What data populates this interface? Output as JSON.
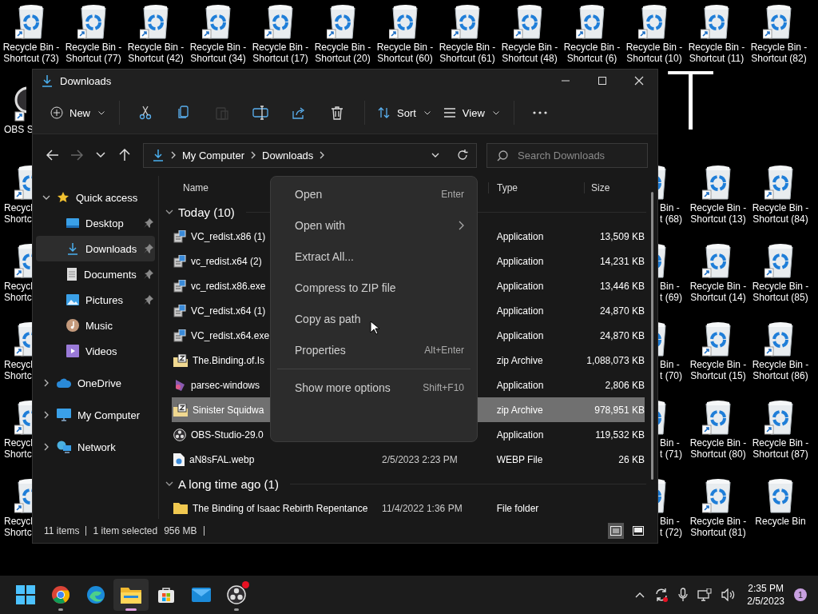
{
  "desktop": {
    "letter": "T",
    "top_row": [
      {
        "kind": "bin",
        "shortcut": true,
        "lines": [
          "Recycle Bin -",
          "Shortcut (73)"
        ]
      },
      {
        "kind": "bin",
        "shortcut": true,
        "lines": [
          "Recycle Bin -",
          "Shortcut (77)"
        ]
      },
      {
        "kind": "bin",
        "shortcut": true,
        "lines": [
          "Recycle Bin -",
          "Shortcut (42)"
        ]
      },
      {
        "kind": "bin",
        "shortcut": true,
        "lines": [
          "Recycle Bin -",
          "Shortcut (34)"
        ]
      },
      {
        "kind": "bin",
        "shortcut": true,
        "lines": [
          "Recycle Bin -",
          "Shortcut (17)"
        ]
      },
      {
        "kind": "bin",
        "shortcut": true,
        "lines": [
          "Recycle Bin -",
          "Shortcut (20)"
        ]
      },
      {
        "kind": "bin",
        "shortcut": true,
        "lines": [
          "Recycle Bin -",
          "Shortcut (60)"
        ]
      },
      {
        "kind": "bin",
        "shortcut": true,
        "lines": [
          "Recycle Bin -",
          "Shortcut (61)"
        ]
      },
      {
        "kind": "bin",
        "shortcut": true,
        "lines": [
          "Recycle Bin -",
          "Shortcut (48)"
        ]
      },
      {
        "kind": "bin",
        "shortcut": true,
        "lines": [
          "Recycle Bin -",
          "Shortcut (6)"
        ]
      },
      {
        "kind": "bin",
        "shortcut": true,
        "lines": [
          "Recycle Bin -",
          "Shortcut (10)"
        ]
      },
      {
        "kind": "bin",
        "shortcut": true,
        "lines": [
          "Recycle Bin -",
          "Shortcut (11)"
        ]
      },
      {
        "kind": "bin",
        "shortcut": true,
        "lines": [
          "Recycle Bin -",
          "Shortcut (82)"
        ]
      }
    ],
    "left_column": [
      {
        "kind": "obs",
        "shortcut": true,
        "lines": [
          "OBS S"
        ]
      },
      {
        "kind": "bin",
        "shortcut": true,
        "lines": [
          "Recycl",
          "Shortc"
        ]
      },
      {
        "kind": "bin",
        "shortcut": true,
        "lines": [
          "Recycl",
          "Shortc"
        ]
      },
      {
        "kind": "bin",
        "shortcut": true,
        "lines": [
          "Recycl",
          "Shortc"
        ]
      },
      {
        "kind": "bin",
        "shortcut": true,
        "lines": [
          "Recycl",
          "Shortc"
        ]
      },
      {
        "kind": "bin",
        "shortcut": true,
        "lines": [
          "Recycl",
          "Shortc"
        ]
      }
    ],
    "right_columns": [
      [
        {
          "kind": "bin",
          "lines": [
            "Bin -",
            "t (68)"
          ]
        },
        {
          "kind": "bin",
          "lines": [
            "Bin -",
            "t (69)"
          ]
        },
        {
          "kind": "bin",
          "lines": [
            "Bin -",
            "t (70)"
          ]
        },
        {
          "kind": "bin",
          "lines": [
            "Bin -",
            "t (71)"
          ]
        },
        {
          "kind": "bin",
          "lines": [
            "Bin -",
            "t (72)"
          ]
        }
      ],
      [
        {
          "kind": "bin",
          "shortcut": true,
          "lines": [
            "Recycle Bin -",
            "Shortcut (13)"
          ]
        },
        {
          "kind": "bin",
          "shortcut": true,
          "lines": [
            "Recycle Bin -",
            "Shortcut (14)"
          ]
        },
        {
          "kind": "bin",
          "shortcut": true,
          "lines": [
            "Recycle Bin -",
            "Shortcut (15)"
          ]
        },
        {
          "kind": "bin",
          "shortcut": true,
          "lines": [
            "Recycle Bin -",
            "Shortcut (80)"
          ]
        },
        {
          "kind": "bin",
          "shortcut": true,
          "lines": [
            "Recycle Bin -",
            "Shortcut (81)"
          ]
        }
      ],
      [
        {
          "kind": "bin",
          "shortcut": true,
          "lines": [
            "Recycle Bin -",
            "Shortcut (84)"
          ]
        },
        {
          "kind": "bin",
          "shortcut": true,
          "lines": [
            "Recycle Bin -",
            "Shortcut (85)"
          ]
        },
        {
          "kind": "bin",
          "shortcut": true,
          "lines": [
            "Recycle Bin -",
            "Shortcut (86)"
          ]
        },
        {
          "kind": "bin",
          "shortcut": true,
          "lines": [
            "Recycle Bin -",
            "Shortcut (87)"
          ]
        },
        {
          "kind": "bin",
          "shortcut": false,
          "lines": [
            "Recycle Bin"
          ]
        }
      ]
    ]
  },
  "window": {
    "title": "Downloads",
    "toolbar": [
      {
        "kind": "new",
        "label": "New",
        "disabled": false
      },
      {
        "kind": "cut",
        "disabled": false
      },
      {
        "kind": "copy",
        "disabled": false
      },
      {
        "kind": "paste",
        "disabled": true
      },
      {
        "kind": "rename",
        "disabled": false
      },
      {
        "kind": "share",
        "disabled": false
      },
      {
        "kind": "delete",
        "disabled": false
      },
      {
        "kind": "sort",
        "label": "Sort",
        "disabled": false
      },
      {
        "kind": "view",
        "label": "View",
        "disabled": false
      },
      {
        "kind": "more",
        "disabled": false
      }
    ],
    "nav": [
      {
        "kind": "back",
        "disabled": false
      },
      {
        "kind": "forward",
        "disabled": true
      },
      {
        "kind": "recent",
        "disabled": false
      },
      {
        "kind": "up",
        "disabled": false
      }
    ],
    "address": [
      "My Computer",
      "Downloads"
    ],
    "search": {
      "placeholder": "Search Downloads"
    },
    "sidebar": {
      "items": [
        {
          "label": "Quick access",
          "kind": "star",
          "expanded": true,
          "selected": false,
          "children": [
            {
              "label": "Desktop",
              "kind": "desktop",
              "pinned": true,
              "selected": false
            },
            {
              "label": "Downloads",
              "kind": "download",
              "pinned": true,
              "selected": true
            },
            {
              "label": "Documents",
              "kind": "documents",
              "pinned": true,
              "selected": false
            },
            {
              "label": "Pictures",
              "kind": "pictures",
              "pinned": true,
              "selected": false
            },
            {
              "label": "Music",
              "kind": "music",
              "pinned": false,
              "selected": false
            },
            {
              "label": "Videos",
              "kind": "videos",
              "pinned": false,
              "selected": false
            }
          ]
        },
        {
          "label": "OneDrive",
          "kind": "cloud",
          "expanded": false,
          "selected": false
        },
        {
          "label": "My Computer",
          "kind": "computer",
          "expanded": false,
          "selected": false
        },
        {
          "label": "Network",
          "kind": "network",
          "expanded": false,
          "selected": false
        }
      ]
    },
    "columns": {
      "name": "Name",
      "type": "Type",
      "size": "Size"
    },
    "groups": [
      {
        "label": "Today (10)",
        "expanded": true,
        "files": [
          {
            "kind": "installer",
            "name": "VC_redist.x86 (1)",
            "type": "Application",
            "size": "13,509 KB",
            "selected": false
          },
          {
            "kind": "installer",
            "name": "vc_redist.x64 (2)",
            "type": "Application",
            "size": "14,231 KB",
            "selected": false
          },
          {
            "kind": "installer",
            "name": "vc_redist.x86.exe",
            "type": "Application",
            "size": "13,446 KB",
            "selected": false
          },
          {
            "kind": "installer",
            "name": "VC_redist.x64 (1)",
            "type": "Application",
            "size": "24,870 KB",
            "selected": false
          },
          {
            "kind": "installer",
            "name": "VC_redist.x64.exe",
            "type": "Application",
            "size": "24,870 KB",
            "selected": false
          },
          {
            "kind": "zip",
            "name": "The.Binding.of.Is",
            "type": "zip Archive",
            "size": "1,088,073 KB",
            "selected": false
          },
          {
            "kind": "parsec",
            "name": "parsec-windows",
            "type": "Application",
            "size": "2,806 KB",
            "selected": false
          },
          {
            "kind": "zip",
            "name": "Sinister Squidwa",
            "type": "zip Archive",
            "size": "978,951 KB",
            "selected": true
          },
          {
            "kind": "obs",
            "name": "OBS-Studio-29.0",
            "type": "Application",
            "size": "119,532 KB",
            "selected": false
          },
          {
            "kind": "webp",
            "name": "aN8sFAL.webp",
            "date": "2/5/2023 2:23 PM",
            "type": "WEBP File",
            "size": "26 KB",
            "selected": false
          }
        ]
      },
      {
        "label": "A long time ago (1)",
        "expanded": true,
        "files": [
          {
            "kind": "folder",
            "name": "The Binding of Isaac Rebirth Repentance",
            "date": "11/4/2022 1:36 PM",
            "type": "File folder",
            "selected": false
          }
        ]
      }
    ],
    "context_menu": [
      {
        "kind": "item",
        "label": "Open",
        "shortcut": "Enter",
        "submenu": false
      },
      {
        "kind": "item",
        "label": "Open with",
        "submenu": true
      },
      {
        "kind": "item",
        "label": "Extract All...",
        "submenu": false
      },
      {
        "kind": "item",
        "label": "Compress to ZIP file",
        "submenu": false
      },
      {
        "kind": "item",
        "label": "Copy as path",
        "submenu": false
      },
      {
        "kind": "item",
        "label": "Properties",
        "shortcut": "Alt+Enter",
        "submenu": false
      },
      {
        "kind": "separator"
      },
      {
        "kind": "item",
        "label": "Show more options",
        "shortcut": "Shift+F10",
        "submenu": false
      }
    ],
    "status_bar": {
      "count": "11 items",
      "selection": "1 item selected",
      "size": "956 MB"
    },
    "views": [
      {
        "kind": "details",
        "selected": true
      },
      {
        "kind": "tiles",
        "selected": false
      }
    ]
  },
  "taskbar": {
    "apps": [
      {
        "kind": "start",
        "running": false,
        "active": false,
        "badge": false
      },
      {
        "kind": "chrome",
        "running": true,
        "active": false,
        "badge": false
      },
      {
        "kind": "edge",
        "running": false,
        "active": false,
        "badge": false
      },
      {
        "kind": "explorer",
        "running": true,
        "active": true,
        "badge": false
      },
      {
        "kind": "store",
        "running": false,
        "active": false,
        "badge": false
      },
      {
        "kind": "mail",
        "running": false,
        "active": false,
        "badge": false
      },
      {
        "kind": "obs",
        "running": true,
        "active": false,
        "badge": true
      }
    ],
    "time": "2:35 PM",
    "date": "2/5/2023",
    "notifications": "1"
  }
}
